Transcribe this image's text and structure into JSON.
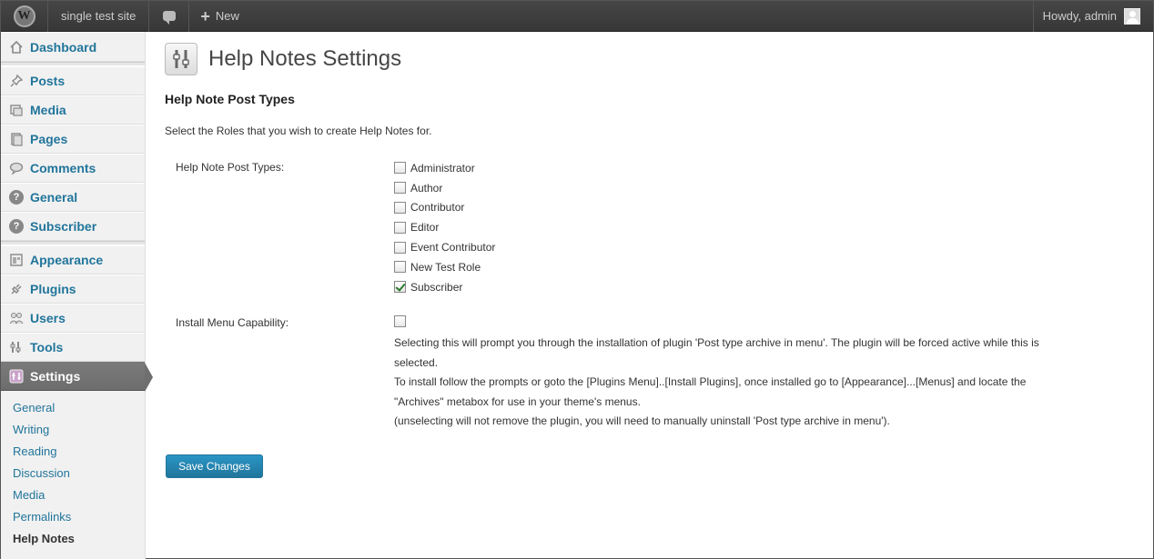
{
  "adminbar": {
    "logo": "W",
    "site_name": "single test site",
    "new_label": "New",
    "howdy": "Howdy, admin"
  },
  "sidebar": {
    "items": [
      {
        "label": "Dashboard",
        "icon": "home-icon"
      },
      {
        "label": "Posts",
        "icon": "pin-icon"
      },
      {
        "label": "Media",
        "icon": "media-icon"
      },
      {
        "label": "Pages",
        "icon": "pages-icon"
      },
      {
        "label": "Comments",
        "icon": "comments-icon"
      },
      {
        "label": "General",
        "icon": "help-icon"
      },
      {
        "label": "Subscriber",
        "icon": "help-icon"
      },
      {
        "label": "Appearance",
        "icon": "appearance-icon"
      },
      {
        "label": "Plugins",
        "icon": "plugin-icon"
      },
      {
        "label": "Users",
        "icon": "users-icon"
      },
      {
        "label": "Tools",
        "icon": "tools-icon"
      },
      {
        "label": "Settings",
        "icon": "settings-icon"
      }
    ],
    "submenu": [
      "General",
      "Writing",
      "Reading",
      "Discussion",
      "Media",
      "Permalinks",
      "Help Notes"
    ]
  },
  "main": {
    "title": "Help Notes Settings",
    "section_title": "Help Note Post Types",
    "intro": "Select the Roles that you wish to create Help Notes for.",
    "post_types_label": "Help Note Post Types:",
    "roles": [
      {
        "label": "Administrator",
        "checked": false
      },
      {
        "label": "Author",
        "checked": false
      },
      {
        "label": "Contributor",
        "checked": false
      },
      {
        "label": "Editor",
        "checked": false
      },
      {
        "label": "Event Contributor",
        "checked": false
      },
      {
        "label": "New Test Role",
        "checked": false
      },
      {
        "label": "Subscriber",
        "checked": true
      }
    ],
    "install_label": "Install Menu Capability:",
    "install_checked": false,
    "desc_lines": [
      "Selecting this will prompt you through the installation of plugin 'Post type archive in menu'. The plugin will be forced active while this is",
      "selected.",
      "To install follow the prompts or goto the [Plugins Menu]..[Install Plugins], once installed go to [Appearance]...[Menus] and locate the",
      "\"Archives\" metabox for use in your theme's menus.",
      "(unselecting will not remove the plugin, you will need to manually uninstall 'Post type archive in menu')."
    ],
    "save_label": "Save Changes"
  },
  "colors": {
    "link": "#21759b",
    "adminbar": "#464646",
    "button": "#21759b"
  }
}
